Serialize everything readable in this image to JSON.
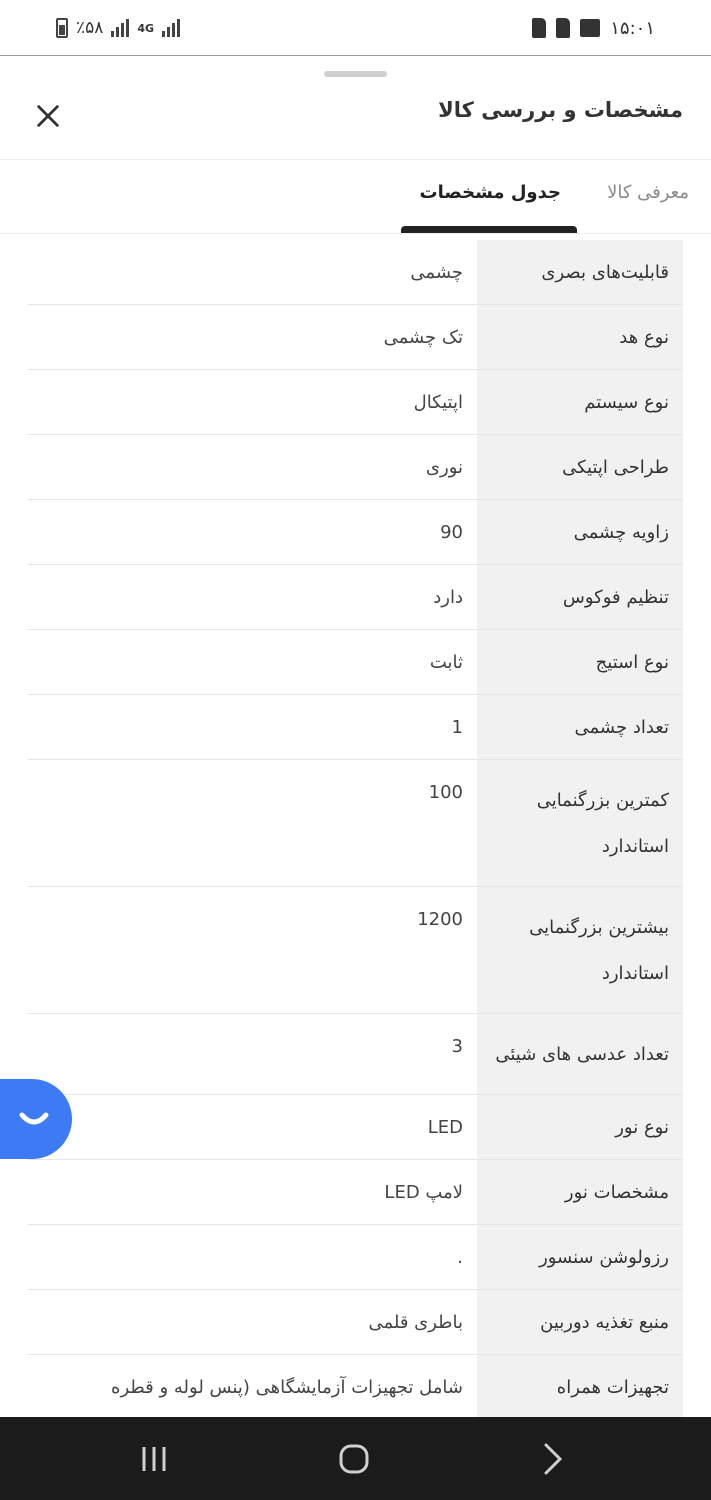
{
  "status_bar": {
    "battery_text": "٪۵۸",
    "network_label": "4G",
    "time": "۱۵:۰۱"
  },
  "header": {
    "title": "مشخصات و بررسی کالا"
  },
  "tabs": [
    {
      "label": "معرفی کالا",
      "active": false
    },
    {
      "label": "جدول مشخصات",
      "active": true
    }
  ],
  "specs": [
    {
      "key": "قابلیت‌های بصری",
      "value": "چشمی"
    },
    {
      "key": "نوع هد",
      "value": "تک چشمی"
    },
    {
      "key": "نوع سیستم",
      "value": "اپتیکال"
    },
    {
      "key": "طراحی اپتیکی",
      "value": "نوری"
    },
    {
      "key": "زاویه چشمی",
      "value": "90"
    },
    {
      "key": "تنظیم فوکوس",
      "value": "دارد"
    },
    {
      "key": "نوع استیج",
      "value": "ثابت"
    },
    {
      "key": "تعداد چشمی",
      "value": "1"
    },
    {
      "key": "کمترین بزرگنمایی استاندارد",
      "value": "100"
    },
    {
      "key": "بیشترین بزرگنمایی استاندارد",
      "value": "1200"
    },
    {
      "key": "تعداد عدسی های شیئی",
      "value": "3"
    },
    {
      "key": "نوع نور",
      "value": "LED"
    },
    {
      "key": "مشخصات نور",
      "value": "لامپ LED"
    },
    {
      "key": "رزولوشن سنسور",
      "value": "."
    },
    {
      "key": "منبع تغذیه دوربین",
      "value": "باطری قلمی"
    },
    {
      "key": "تجهیزات همراه",
      "value": "شامل تجهیزات آزمایشگاهی (پنس لوله و قطره"
    }
  ],
  "colors": {
    "accent": "#3d7bf5",
    "key_bg": "#f1f1f1",
    "nav_bg": "#1b1b1b"
  }
}
